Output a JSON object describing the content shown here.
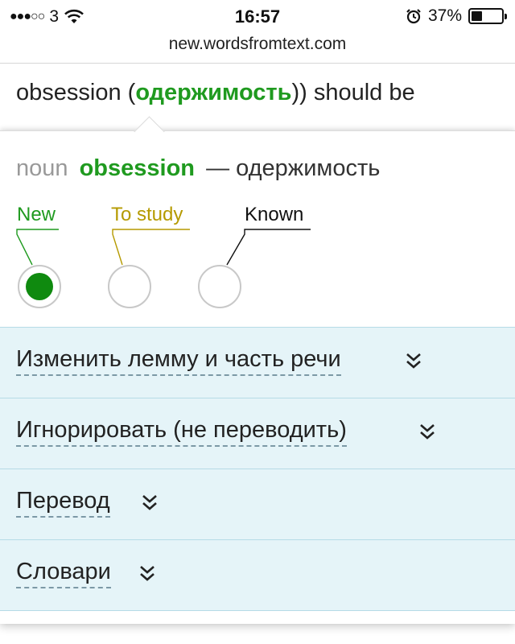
{
  "status_bar": {
    "signal_dots": "●●●○○",
    "carrier": "3",
    "time": "16:57",
    "battery_percent": "37%",
    "battery_level": 0.37,
    "icons": [
      "wifi-icon",
      "alarm-icon",
      "battery-icon"
    ]
  },
  "url": "new.wordsfromtext.com",
  "article": {
    "before": "obsession (",
    "translation": "одержимость",
    "after": ")) should be"
  },
  "popup": {
    "part_of_speech": "noun",
    "word": "obsession",
    "translation": "— одержимость",
    "statuses": [
      {
        "label": "New",
        "color": "#1f9a1f",
        "selected": true
      },
      {
        "label": "To study",
        "color": "#b59a00",
        "selected": false
      },
      {
        "label": "Known",
        "color": "#111111",
        "selected": false
      }
    ],
    "sections": [
      {
        "label": "Изменить лемму и часть речи"
      },
      {
        "label": "Игнорировать (не переводить)"
      },
      {
        "label": "Перевод"
      },
      {
        "label": "Словари"
      }
    ]
  },
  "colors": {
    "accent_green": "#1f9a1f",
    "accordion_bg": "#e5f4f8",
    "to_study": "#b59a00"
  }
}
